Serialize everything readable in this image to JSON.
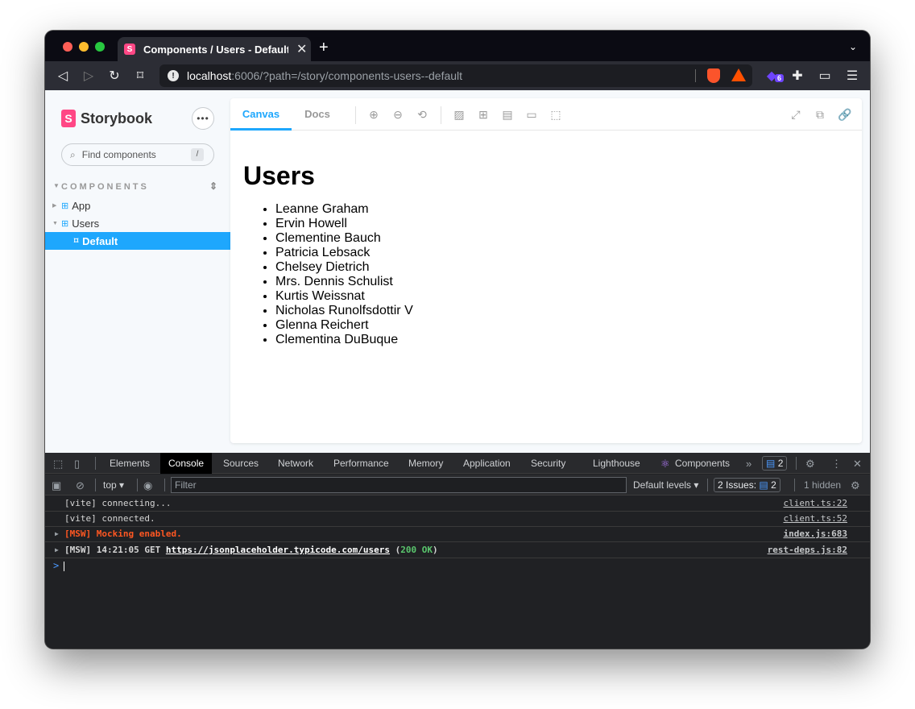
{
  "browser": {
    "tab_title": "Components / Users - Default",
    "tab_favicon": "S",
    "tab_close": "✕",
    "new_tab": "+",
    "url_host": "localhost",
    "url_path": ":6006/?path=/story/components-users--default",
    "extension_badge": "6"
  },
  "storybook": {
    "logo_text": "Storybook",
    "menu_label": "•••",
    "search_placeholder": "Find components",
    "search_shortcut": "/",
    "section_label": "COMPONENTS",
    "tree": [
      {
        "label": "App",
        "kind": "component"
      },
      {
        "label": "Users",
        "kind": "component"
      },
      {
        "label": "Default",
        "kind": "story",
        "active": true
      }
    ],
    "toolbar_tabs": [
      "Canvas",
      "Docs"
    ],
    "active_tab": "Canvas"
  },
  "preview": {
    "heading": "Users",
    "users": [
      "Leanne Graham",
      "Ervin Howell",
      "Clementine Bauch",
      "Patricia Lebsack",
      "Chelsey Dietrich",
      "Mrs. Dennis Schulist",
      "Kurtis Weissnat",
      "Nicholas Runolfsdottir V",
      "Glenna Reichert",
      "Clementina DuBuque"
    ]
  },
  "devtools": {
    "tabs": [
      "Elements",
      "Console",
      "Sources",
      "Network",
      "Performance",
      "Memory",
      "Application",
      "Security",
      "Lighthouse",
      "Components"
    ],
    "active_tab": "Console",
    "messages_count": "2",
    "context": "top",
    "filter_placeholder": "Filter",
    "levels": "Default levels",
    "issues_label": "2 Issues:",
    "issues_count": "2",
    "hidden_label": "1 hidden",
    "console": [
      {
        "text": "[vite] connecting...",
        "source": "client.ts:22"
      },
      {
        "text": "[vite] connected.",
        "source": "client.ts:52"
      },
      {
        "text": "[MSW] Mocking enabled.",
        "source": "index.js:683"
      },
      {
        "prefix": "[MSW] 14:21:05 GET ",
        "url": "https://jsonplaceholder.typicode.com/users",
        "open": " (",
        "status": "200 OK",
        "close": ")",
        "source": "rest-deps.js:82"
      }
    ],
    "prompt": ">"
  },
  "colors": {
    "accent": "#1ea7fd",
    "brand": "#ff4785",
    "warn": "#ff5722",
    "ok": "#5ac66d"
  }
}
